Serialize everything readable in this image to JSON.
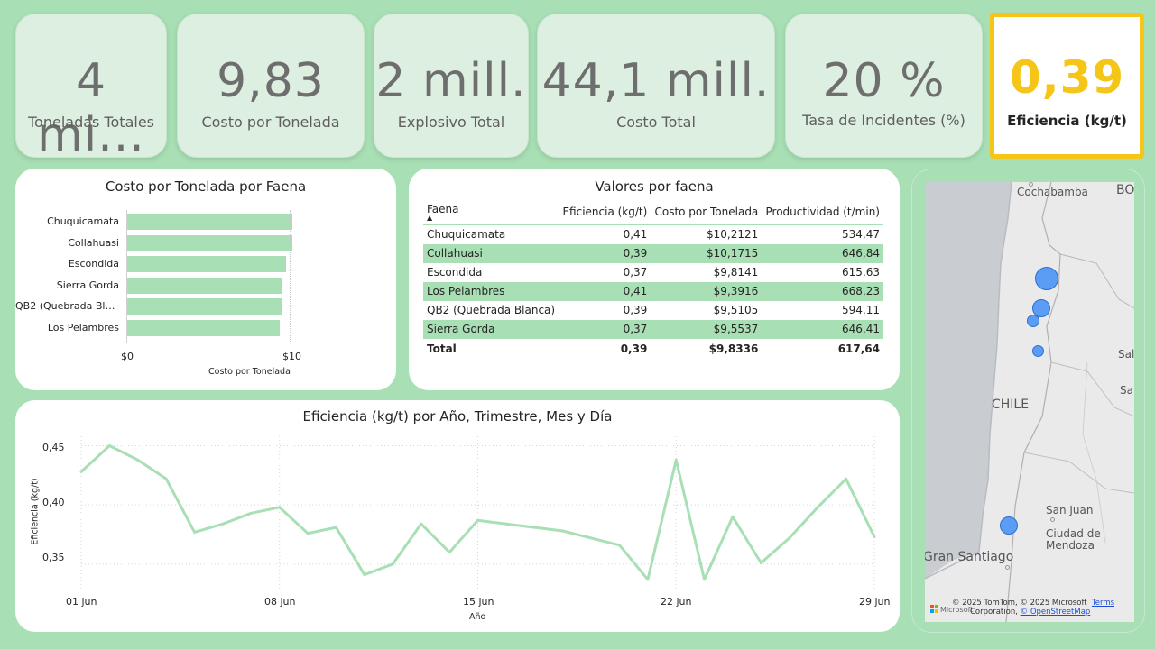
{
  "kpis": [
    {
      "value": "4 mi...",
      "label": "Toneladas Totales"
    },
    {
      "value": "9,83",
      "label": "Costo por Tonelada"
    },
    {
      "value": "2 mill.",
      "label": "Explosivo Total"
    },
    {
      "value": "44,1 mill.",
      "label": "Costo Total"
    },
    {
      "value": "20 %",
      "label": "Tasa de Incidentes (%)"
    },
    {
      "value": "0,39",
      "label": "Eficiencia (kg/t)"
    }
  ],
  "colors": {
    "background": "#a8dfb4",
    "accent": "#f5c518",
    "series": "#a8dfb4",
    "bubble": "#5b9cf4"
  },
  "bar_chart": {
    "title": "Costo por Tonelada por Faena",
    "xlabel": "Costo por Tonelada",
    "ticks": [
      "$0",
      "$10"
    ]
  },
  "table": {
    "title": "Valores por faena",
    "columns": [
      "Faena",
      "Eficiencia (kg/t)",
      "Costo por Tonelada",
      "Productividad (t/min)"
    ],
    "rows": [
      [
        "Chuquicamata",
        "0,41",
        "$10,2121",
        "534,47"
      ],
      [
        "Collahuasi",
        "0,39",
        "$10,1715",
        "646,84"
      ],
      [
        "Escondida",
        "0,37",
        "$9,8141",
        "615,63"
      ],
      [
        "Los Pelambres",
        "0,41",
        "$9,3916",
        "668,23"
      ],
      [
        "QB2 (Quebrada Blanca)",
        "0,39",
        "$9,5105",
        "594,11"
      ],
      [
        "Sierra Gorda",
        "0,37",
        "$9,5537",
        "646,41"
      ]
    ],
    "total": [
      "Total",
      "0,39",
      "$9,8336",
      "617,64"
    ]
  },
  "line_chart": {
    "title": "Eficiencia (kg/t) por Año, Trimestre, Mes y Día",
    "xlabel": "Año",
    "ylabel": "Eficiencia (kg/t)",
    "yticks": [
      "0,45",
      "0,40",
      "0,35"
    ],
    "xticks": [
      "01 jun",
      "08 jun",
      "15 jun",
      "22 jun",
      "29 jun"
    ]
  },
  "map": {
    "labels": [
      "Cochabamba",
      "BO",
      "CHILE",
      "Salt",
      "Sa",
      "San Juan",
      "Ciudad de",
      "Mendoza",
      "Gran Santiago"
    ],
    "attribution": "© 2025 TomTom, © 2025 Microsoft",
    "attribution2": "Corporation,",
    "terms": "Terms",
    "osm": "© OpenStreetMap",
    "ms_logo_text": "Microsoft"
  },
  "chart_data": [
    {
      "type": "bar",
      "title": "Costo por Tonelada por Faena",
      "categories": [
        "Chuquicamata",
        "Collahuasi",
        "Escondida",
        "Sierra Gorda",
        "QB2 (Quebrada Blanca)",
        "Los Pelambres"
      ],
      "values": [
        10.2121,
        10.1715,
        9.8141,
        9.5537,
        9.5105,
        9.3916
      ],
      "xlabel": "Costo por Tonelada",
      "xlim": [
        0,
        11
      ]
    },
    {
      "type": "line",
      "title": "Eficiencia (kg/t) por Año, Trimestre, Mes y Día",
      "xlabel": "Año",
      "ylabel": "Eficiencia (kg/t)",
      "x": [
        "01 jun",
        "02 jun",
        "03 jun",
        "04 jun",
        "05 jun",
        "06 jun",
        "07 jun",
        "08 jun",
        "09 jun",
        "10 jun",
        "11 jun",
        "12 jun",
        "13 jun",
        "14 jun",
        "15 jun",
        "16 jun",
        "17 jun",
        "18 jun",
        "19 jun",
        "20 jun",
        "21 jun",
        "22 jun",
        "23 jun",
        "24 jun",
        "25 jun",
        "26 jun",
        "27 jun",
        "28 jun",
        "29 jun"
      ],
      "values": [
        0.428,
        0.45,
        0.438,
        0.422,
        0.377,
        0.384,
        0.393,
        0.398,
        0.376,
        0.381,
        0.341,
        0.35,
        0.384,
        0.36,
        0.387,
        0.384,
        0.381,
        0.378,
        0.372,
        0.366,
        0.337,
        0.438,
        0.337,
        0.39,
        0.351,
        0.372,
        0.398,
        0.422,
        0.373
      ],
      "ylim": [
        0.327,
        0.458
      ]
    }
  ]
}
